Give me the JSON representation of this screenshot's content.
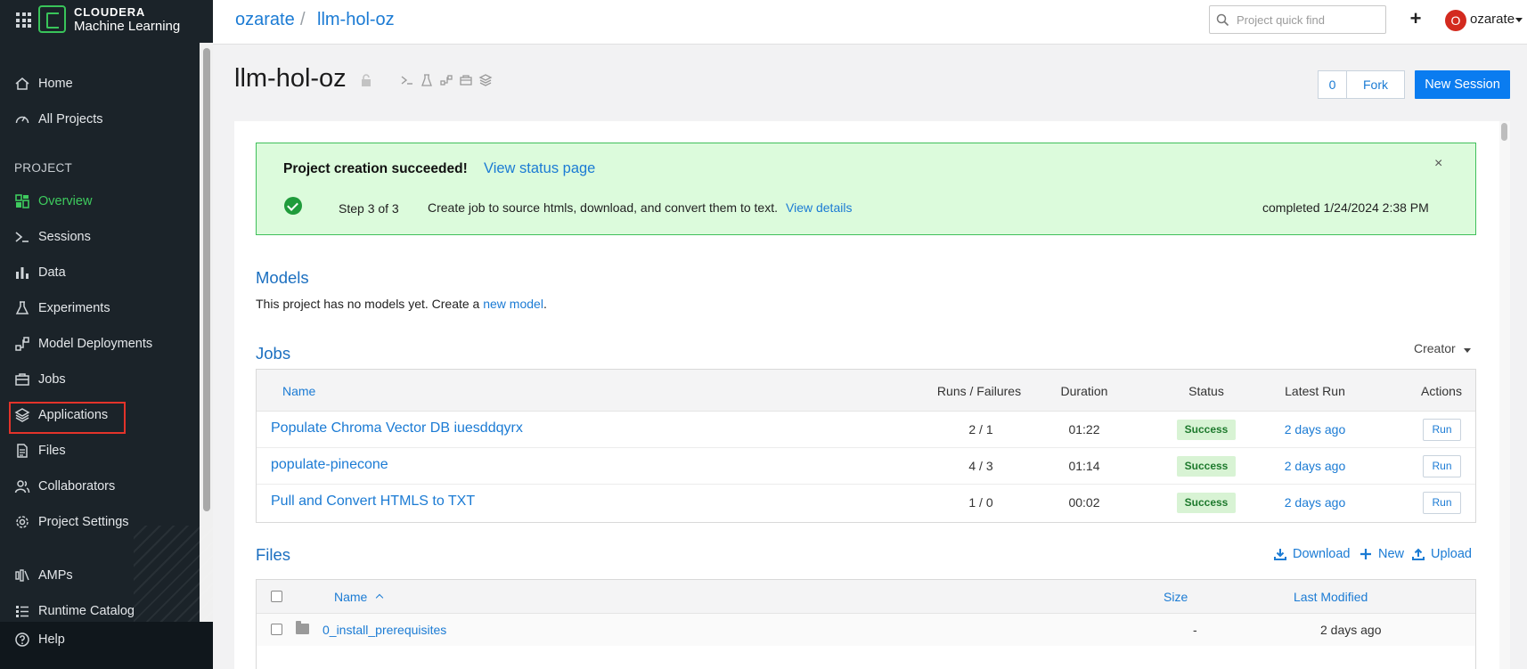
{
  "brand": {
    "line1": "CLOUDERA",
    "line2": "Machine Learning"
  },
  "sidebar": {
    "top_items": [
      {
        "label": "Home",
        "icon": "home-icon"
      },
      {
        "label": "All Projects",
        "icon": "gauge-icon"
      }
    ],
    "section_label": "PROJECT",
    "project_items": [
      {
        "label": "Overview",
        "icon": "overview-icon",
        "active": true
      },
      {
        "label": "Sessions",
        "icon": "terminal-icon"
      },
      {
        "label": "Data",
        "icon": "bar-chart-icon"
      },
      {
        "label": "Experiments",
        "icon": "flask-icon"
      },
      {
        "label": "Model Deployments",
        "icon": "model-icon"
      },
      {
        "label": "Jobs",
        "icon": "briefcase-icon"
      },
      {
        "label": "Applications",
        "icon": "layers-icon"
      },
      {
        "label": "Files",
        "icon": "file-icon"
      },
      {
        "label": "Collaborators",
        "icon": "users-icon"
      },
      {
        "label": "Project Settings",
        "icon": "gear-icon"
      }
    ],
    "bottom_items": [
      {
        "label": "AMPs",
        "icon": "amps-icon"
      },
      {
        "label": "Runtime Catalog",
        "icon": "list-icon"
      }
    ],
    "help_label": "Help"
  },
  "topbar": {
    "breadcrumb": [
      "ozarate",
      "llm-hol-oz"
    ],
    "breadcrumb_separator": "/",
    "quickfind_placeholder": "Project quick find",
    "plus_label": "+",
    "avatar_initial": "O",
    "user_name": "ozarate"
  },
  "header": {
    "title": "llm-hol-oz",
    "star_count": "0",
    "fork_label": "Fork",
    "new_session_label": "New Session"
  },
  "alert": {
    "title": "Project creation succeeded!",
    "status_link": "View status page",
    "close": "×",
    "step": "Step 3 of 3",
    "description": "Create job to source htmls, download, and convert them to text.",
    "details_link": "View details",
    "completed": "completed 1/24/2024 2:38 PM"
  },
  "models": {
    "heading": "Models",
    "text": "This project has no models yet. Create a",
    "link": "new model",
    "period": "."
  },
  "jobs": {
    "heading": "Jobs",
    "creator_filter": "Creator",
    "columns": {
      "name": "Name",
      "runs": "Runs / Failures",
      "duration": "Duration",
      "status": "Status",
      "latest": "Latest Run",
      "actions": "Actions"
    },
    "rows": [
      {
        "name": "Populate Chroma Vector DB iuesddqyrx",
        "runs": "2 / 1",
        "duration": "01:22",
        "status": "Success",
        "latest": "2 days ago",
        "action": "Run"
      },
      {
        "name": "populate-pinecone",
        "runs": "4 / 3",
        "duration": "01:14",
        "status": "Success",
        "latest": "2 days ago",
        "action": "Run"
      },
      {
        "name": "Pull and Convert HTMLS to TXT",
        "runs": "1 / 0",
        "duration": "00:02",
        "status": "Success",
        "latest": "2 days ago",
        "action": "Run"
      }
    ]
  },
  "files": {
    "heading": "Files",
    "actions": {
      "download": "Download",
      "new": "New",
      "upload": "Upload"
    },
    "columns": {
      "name": "Name",
      "size": "Size",
      "modified": "Last Modified"
    },
    "rows": [
      {
        "name": "0_install_prerequisites",
        "size": "-",
        "modified": "2 days ago"
      }
    ]
  },
  "colors": {
    "sidebar_bg": "#1b2329",
    "accent_green": "#3ecb5e",
    "link_blue": "#1b7bd4",
    "primary_button": "#0a7cf0",
    "success_bg": "#dcfbdc",
    "highlight_red": "#e3332a"
  }
}
